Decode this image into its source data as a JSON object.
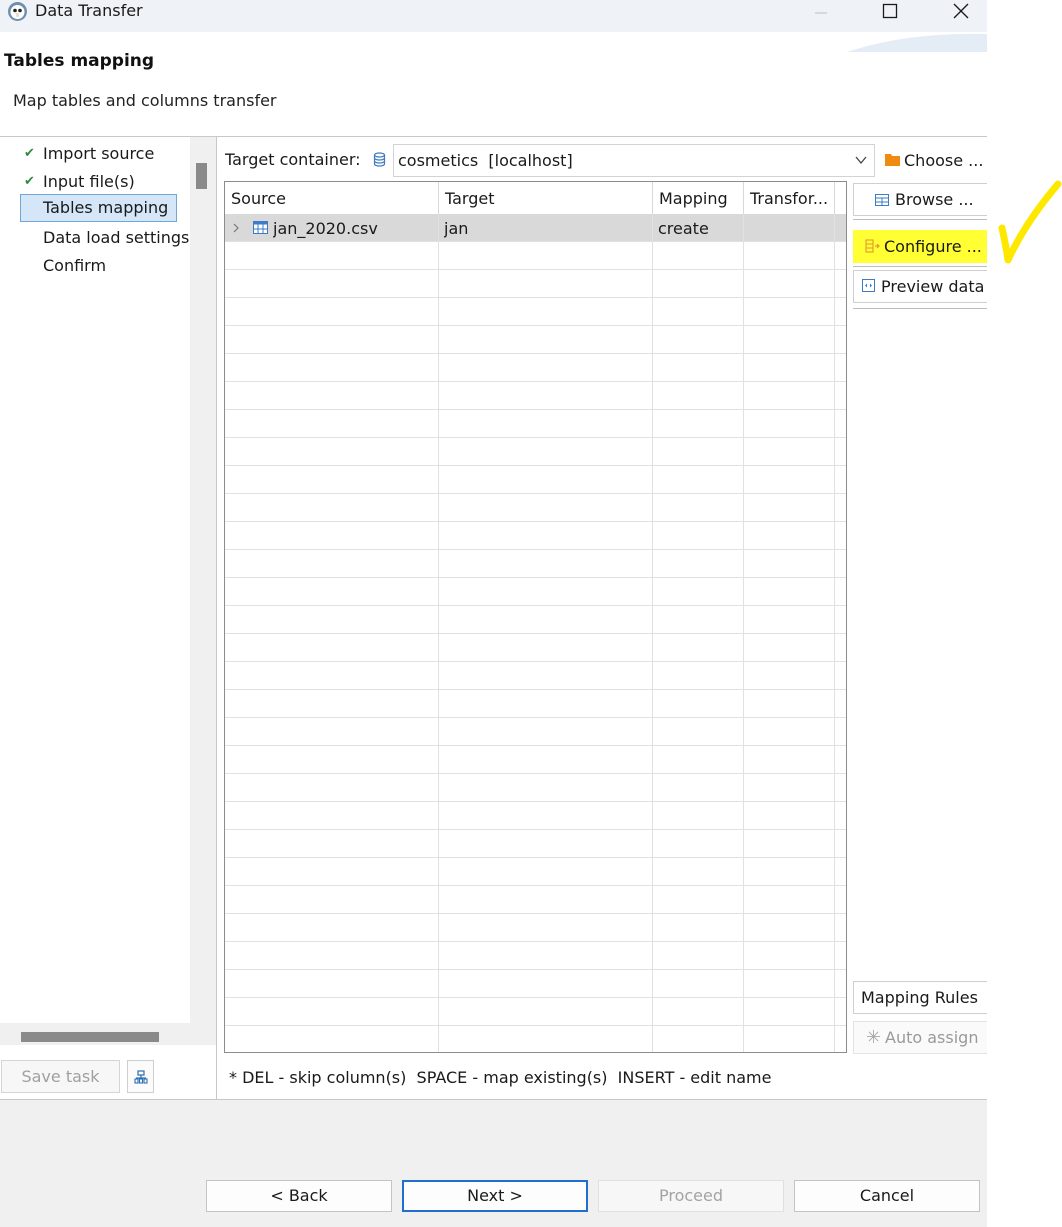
{
  "window": {
    "title": "Data Transfer",
    "icon": "dbeaver-icon"
  },
  "header": {
    "title": "Tables mapping",
    "subtitle": "Map tables and columns transfer"
  },
  "nav": {
    "items": [
      {
        "label": "Import source",
        "done": true
      },
      {
        "label": "Input file(s)",
        "done": true
      },
      {
        "label": "Tables mapping",
        "selected": true
      },
      {
        "label": "Data load settings"
      },
      {
        "label": "Confirm"
      }
    ],
    "save_task": "Save task"
  },
  "target": {
    "label": "Target container:",
    "value": "cosmetics  [localhost]",
    "choose_label": "Choose ..."
  },
  "table": {
    "columns": [
      "Source",
      "Target",
      "Mapping",
      "Transfor..."
    ],
    "rows": [
      {
        "source": "jan_2020.csv",
        "target": "jan",
        "mapping": "create",
        "transform": ""
      }
    ]
  },
  "side_buttons": {
    "browse": "Browse ...",
    "configure": "Configure ...",
    "preview": "Preview data",
    "mapping_rules": "Mapping Rules",
    "auto_assign": "Auto assign"
  },
  "hint": "* DEL - skip column(s)  SPACE - map existing(s)  INSERT - edit name",
  "footer": {
    "back": "< Back",
    "next": "Next >",
    "proceed": "Proceed",
    "cancel": "Cancel"
  },
  "colors": {
    "highlight": "#ffff33",
    "selection": "#d4e6f7",
    "check": "#2e8b3a",
    "default_button": "#1f6fd1"
  }
}
